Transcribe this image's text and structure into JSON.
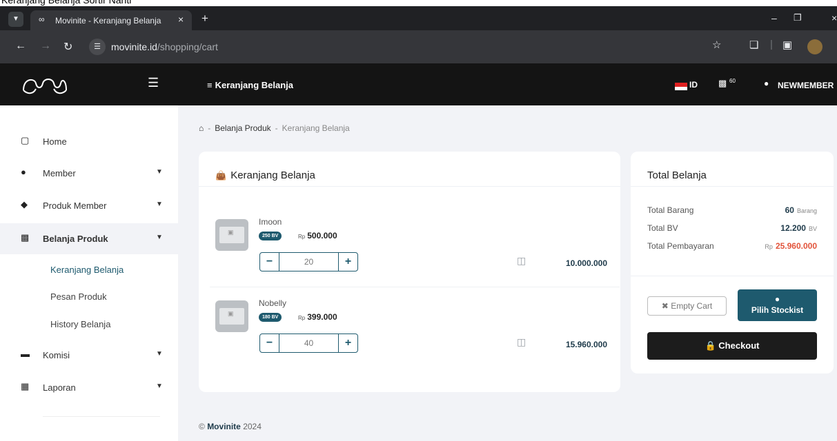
{
  "top_caption": "Keranjang Belanja Sortir Nanti",
  "browser": {
    "tab_title": "Movinite - Keranjang Belanja",
    "url_host": "movinite.id",
    "url_path": "/shopping/cart"
  },
  "header": {
    "page_title": "Keranjang Belanja",
    "lang": "ID",
    "cart_count": "60",
    "username": "NEWMEMBER"
  },
  "sidebar": {
    "items": [
      {
        "label": "Home"
      },
      {
        "label": "Member"
      },
      {
        "label": "Produk Member"
      },
      {
        "label": "Belanja Produk"
      },
      {
        "label": "Komisi"
      },
      {
        "label": "Laporan"
      }
    ],
    "subitems": [
      {
        "label": "Keranjang Belanja"
      },
      {
        "label": "Pesan Produk"
      },
      {
        "label": "History Belanja"
      }
    ]
  },
  "breadcrumb": {
    "sep": "-",
    "item1": "Belanja Produk",
    "item2": "Keranjang Belanja"
  },
  "cart": {
    "title": "Keranjang Belanja",
    "currency": "Rp",
    "items": [
      {
        "name": "Imoon",
        "bv": "250 BV",
        "price": "500.000",
        "qty": "20",
        "subtotal": "10.000.000"
      },
      {
        "name": "Nobelly",
        "bv": "180 BV",
        "price": "399.000",
        "qty": "40",
        "subtotal": "15.960.000"
      }
    ]
  },
  "summary": {
    "title": "Total Belanja",
    "rows": [
      {
        "label": "Total Barang",
        "value": "60",
        "unit": "Barang"
      },
      {
        "label": "Total BV",
        "value": "12.200",
        "unit": "BV"
      },
      {
        "label": "Total Pembayaran",
        "prefix": "Rp",
        "value": "25.960.000"
      }
    ],
    "empty_cart": "Empty Cart",
    "pilih_stockist": "Pilih Stockist",
    "checkout": "Checkout"
  },
  "footer": {
    "brand": "Movinite",
    "year": "2024"
  },
  "colors": {
    "accent": "#1e5a6e",
    "total_red": "#e2533a",
    "header_bg": "#141414"
  },
  "icons": [
    "home-icon",
    "breadcrumb-home-icon",
    "bag-icon",
    "trash-icon",
    "cart-icon",
    "user-icon",
    "menu-icon",
    "logo"
  ]
}
